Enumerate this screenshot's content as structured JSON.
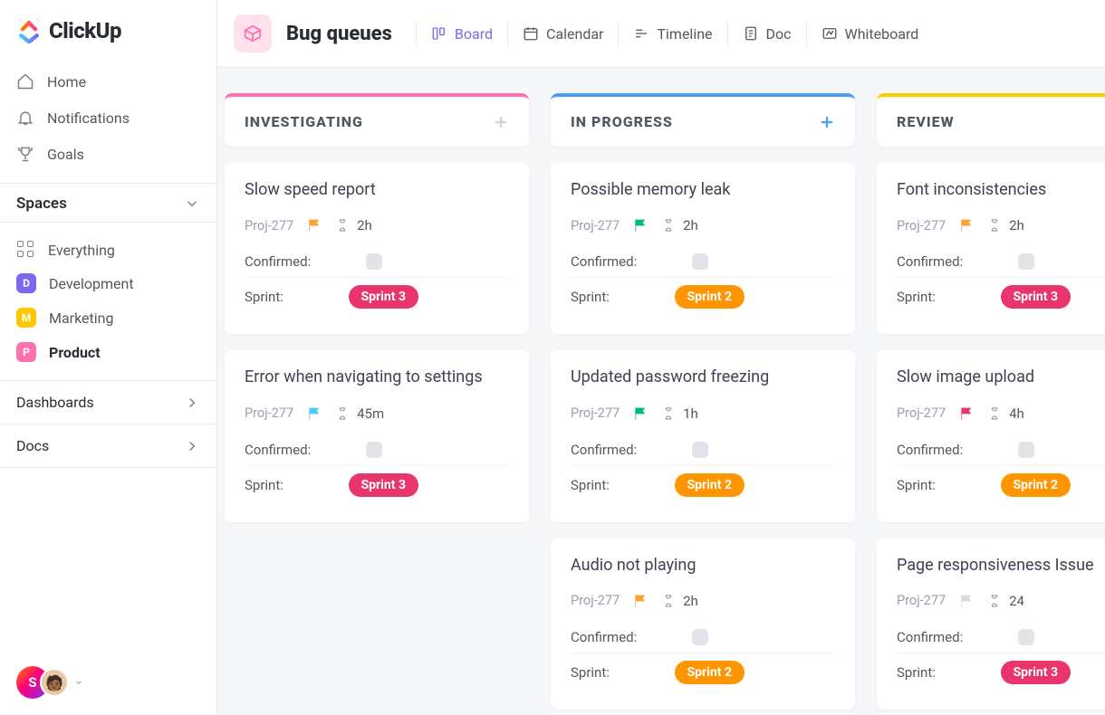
{
  "brand": {
    "name": "ClickUp"
  },
  "nav": [
    {
      "key": "home",
      "label": "Home"
    },
    {
      "key": "notifications",
      "label": "Notifications"
    },
    {
      "key": "goals",
      "label": "Goals"
    }
  ],
  "spaces_header": "Spaces",
  "everything_label": "Everything",
  "spaces": [
    {
      "key": "development",
      "label": "Development",
      "letter": "D",
      "color": "#7b68ee"
    },
    {
      "key": "marketing",
      "label": "Marketing",
      "letter": "M",
      "color": "#ffc800"
    },
    {
      "key": "product",
      "label": "Product",
      "letter": "P",
      "color": "#fd71af",
      "active": true
    }
  ],
  "sections": [
    {
      "key": "dashboards",
      "label": "Dashboards"
    },
    {
      "key": "docs",
      "label": "Docs"
    }
  ],
  "avatar_letter": "S",
  "page": {
    "title": "Bug queues"
  },
  "views": [
    {
      "key": "board",
      "label": "Board",
      "active": true
    },
    {
      "key": "calendar",
      "label": "Calendar"
    },
    {
      "key": "timeline",
      "label": "Timeline"
    },
    {
      "key": "doc",
      "label": "Doc"
    },
    {
      "key": "whiteboard",
      "label": "Whiteboard"
    }
  ],
  "columns": [
    {
      "key": "investigating",
      "name": "INVESTIGATING",
      "color": "#fd71af",
      "plus_color": "#cfd3db",
      "cards": [
        {
          "title": "Slow speed report",
          "project": "Proj-277",
          "flag_color": "#ffa12f",
          "duration": "2h",
          "confirmed_label": "Confirmed:",
          "sprint_label": "Sprint:",
          "sprint": "Sprint 3",
          "sprint_color": "#e8356c"
        },
        {
          "title": "Error when navigating to settings",
          "project": "Proj-277",
          "flag_color": "#49ccf9",
          "duration": "45m",
          "confirmed_label": "Confirmed:",
          "sprint_label": "Sprint:",
          "sprint": "Sprint 3",
          "sprint_color": "#e8356c"
        }
      ]
    },
    {
      "key": "inprogress",
      "name": "IN PROGRESS",
      "color": "#4a9df8",
      "plus_color": "#4a9df8",
      "cards": [
        {
          "title": "Possible memory leak",
          "project": "Proj-277",
          "flag_color": "#00b884",
          "duration": "2h",
          "confirmed_label": "Confirmed:",
          "sprint_label": "Sprint:",
          "sprint": "Sprint 2",
          "sprint_color": "#ff9500"
        },
        {
          "title": "Updated password freezing",
          "project": "Proj-277",
          "flag_color": "#00b884",
          "duration": "1h",
          "confirmed_label": "Confirmed:",
          "sprint_label": "Sprint:",
          "sprint": "Sprint 2",
          "sprint_color": "#ff9500"
        },
        {
          "title": "Audio not playing",
          "project": "Proj-277",
          "flag_color": "#ffa12f",
          "duration": "2h",
          "confirmed_label": "Confirmed:",
          "sprint_label": "Sprint:",
          "sprint": "Sprint 2",
          "sprint_color": "#ff9500"
        }
      ]
    },
    {
      "key": "review",
      "name": "REVIEW",
      "color": "#ffcc00",
      "plus_color": "#cfd3db",
      "cards": [
        {
          "title": "Font inconsistencies",
          "project": "Proj-277",
          "flag_color": "#ffa12f",
          "duration": "2h",
          "confirmed_label": "Confirmed:",
          "sprint_label": "Sprint:",
          "sprint": "Sprint 3",
          "sprint_color": "#e8356c"
        },
        {
          "title": "Slow image upload",
          "project": "Proj-277",
          "flag_color": "#e8356c",
          "duration": "4h",
          "confirmed_label": "Confirmed:",
          "sprint_label": "Sprint:",
          "sprint": "Sprint 2",
          "sprint_color": "#ff9500"
        },
        {
          "title": "Page responsiveness Issue",
          "project": "Proj-277",
          "flag_color": "#d5d9e0",
          "duration": "24",
          "confirmed_label": "Confirmed:",
          "sprint_label": "Sprint:",
          "sprint": "Sprint 3",
          "sprint_color": "#e8356c"
        }
      ]
    }
  ]
}
